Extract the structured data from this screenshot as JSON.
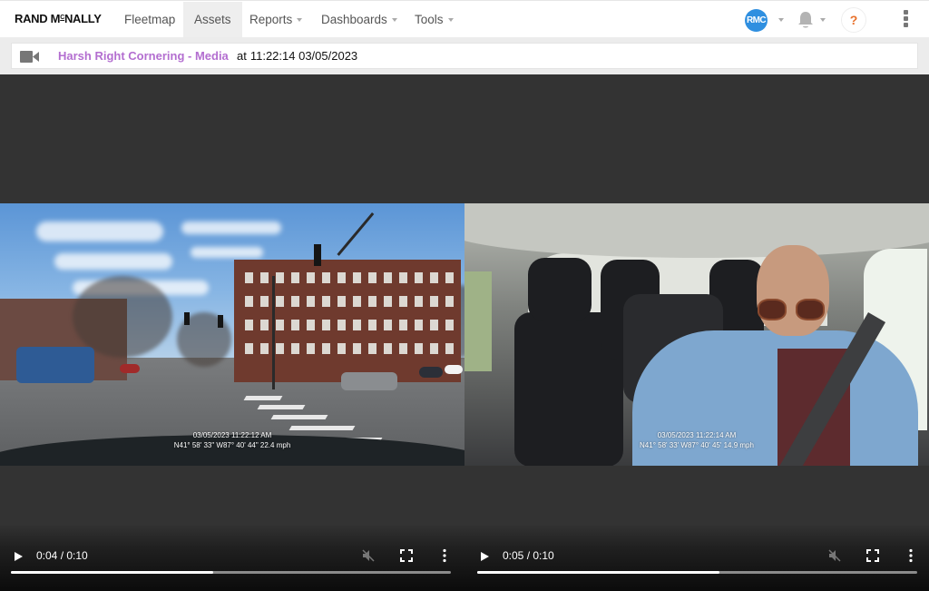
{
  "nav": {
    "logo": "RAND MCNALLY",
    "items": [
      {
        "label": "Fleetmap",
        "has_caret": false,
        "active": false
      },
      {
        "label": "Assets",
        "has_caret": false,
        "active": true
      },
      {
        "label": "Reports",
        "has_caret": true,
        "active": false
      },
      {
        "label": "Dashboards",
        "has_caret": true,
        "active": false
      },
      {
        "label": "Tools",
        "has_caret": true,
        "active": false
      }
    ],
    "avatar_initials": "RMC",
    "help_label": "?",
    "icons": {
      "notifications": "bell-icon",
      "more": "kebab-menu-icon"
    }
  },
  "event": {
    "icon": "video-camera-icon",
    "title": "Harsh Right Cornering - Media",
    "at_label": "at",
    "timestamp": "11:22:14 03/05/2023",
    "title_color": "#b36ed0"
  },
  "videos": [
    {
      "camera": "road-facing",
      "overlay_line1": "03/05/2023 11:22:12 AM",
      "overlay_line2": "N41° 58' 33\" W87° 40' 44\" 22.4 mph",
      "current_time": "0:04",
      "duration": "0:10",
      "time_label": "0:04 / 0:10",
      "progress_fraction": 0.46,
      "muted": true
    },
    {
      "camera": "driver-facing",
      "overlay_line1": "03/05/2023 11:22:14 AM",
      "overlay_line2": "N41° 58' 33' W87° 40' 45' 14.9 mph",
      "current_time": "0:05",
      "duration": "0:10",
      "time_label": "0:05 / 0:10",
      "progress_fraction": 0.55,
      "muted": true
    }
  ],
  "control_icons": [
    "play-icon",
    "mute-icon",
    "fullscreen-icon",
    "more-options-icon"
  ]
}
